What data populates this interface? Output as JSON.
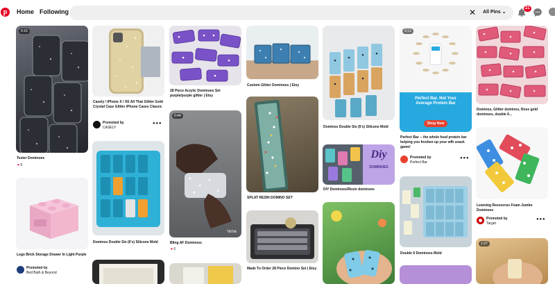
{
  "header": {
    "home_label": "Home",
    "following_label": "Following",
    "search_value": "",
    "search_clear": "✕",
    "filter_label": "All Pins",
    "notification_count": "21"
  },
  "pins": {
    "tester": {
      "time": "0:15",
      "title": "Tester Dominoes",
      "reactions": "8"
    },
    "iphone": {
      "title": "Casely / iPhone X / XS All That Glitter Gold Crystal Case Glitter iPhone Cases Classic",
      "promoted_label": "Promoted by",
      "advertiser": "CASELY"
    },
    "acrylic": {
      "title": "28 Piece Acrylic Dominoes Set purple/purple glitter | Etsy"
    },
    "custom_glitter": {
      "title": "Custom Glitter Dominoes | Etsy"
    },
    "double_six_blue": {
      "title": "Dominos Double Six (6's) Silicone Mold"
    },
    "perfect_bar": {
      "time": "0:13",
      "ad_headline": "Perfect Bar. Not Your Average Protein Bar",
      "cta": "Shop Now",
      "title": "Perfect Bar -- the whole food protein bar helping you freshen up your wfh snack game!",
      "promoted_label": "Promoted by",
      "advertiser": "Perfect Bar"
    },
    "rose_gold": {
      "title": "Dominos, Glitter dominos, Rose gold dominoes, double 6..."
    },
    "bling": {
      "time": "0:44",
      "title": "Bling AF Dominoes",
      "reactions": "6",
      "watermark": "TikTok"
    },
    "splat": {
      "title": "SPLAT RESIN DOMINO SET"
    },
    "diy": {
      "title": "DIY Dominoes/Resin dominoes",
      "overlay_word": "Diy",
      "overlay_sub": "DOMINOES"
    },
    "double_six_blue2": {
      "title": "Dominos Double Six (6's) Silicone Mold"
    },
    "lego": {
      "title": "Lego Brick Storage Drawer In Light Purple",
      "promoted_label": "Promoted by",
      "advertiser": "Bed Bath & Beyond"
    },
    "double_six_mold": {
      "title": "Double 6 Dominoes Mold"
    },
    "learning": {
      "title": "Learning Resources Foam Jumbo Dominoes",
      "promoted_label": "Promoted by",
      "advertiser": "Target"
    },
    "made_to_order": {
      "title": "Made To Order 28 Piece Domino Set | Etsy"
    },
    "hand_video": {
      "time": "1:37"
    }
  },
  "more_label": "•••",
  "colors": {
    "accent": "#e60023",
    "search_bg": "#efefef",
    "glitter_dark": "#3a3d44",
    "purple": "#7a52c8",
    "teal": "#2fb0d6",
    "pink": "#e05a7a",
    "perfect_green": "#27a9df"
  }
}
